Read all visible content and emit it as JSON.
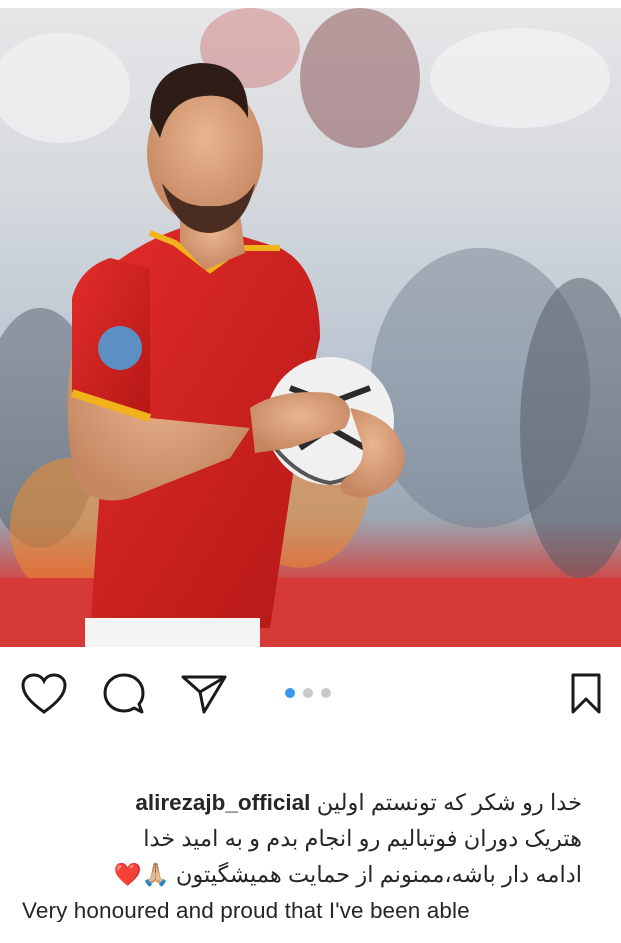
{
  "post": {
    "image_alt": "Footballer in red AFAS jersey holding match ball",
    "carousel": {
      "total": 3,
      "active": 1
    }
  },
  "actions": {
    "like_icon": "heart-icon",
    "comment_icon": "comment-icon",
    "share_icon": "paper-plane-icon",
    "save_icon": "bookmark-icon"
  },
  "caption": {
    "username": "alirezajb_official",
    "line1": "خدا رو شکر که تونستم اولین",
    "line2": "هتریک دوران فوتبالیم رو انجام بدم و به امید خدا",
    "line3": "ادامه دار باشه،ممنونم از حمایت همیشگیتون",
    "line3_emojis": "🙏🏼❤️",
    "english_line": "Very honoured and proud that I've been able"
  },
  "colors": {
    "accent_blue": "#3897f0",
    "text": "#262626",
    "jersey_red": "#d8201f"
  }
}
